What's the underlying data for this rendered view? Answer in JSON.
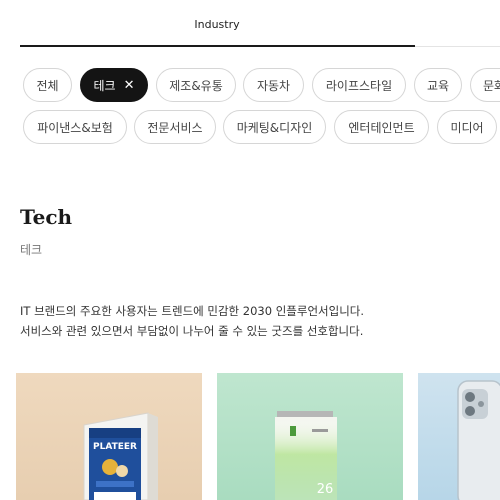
{
  "tabs": {
    "active_label": "Industry"
  },
  "filters": {
    "row1": [
      {
        "label": "전체",
        "active": false
      },
      {
        "label": "테크",
        "active": true
      },
      {
        "label": "제조&유통",
        "active": false
      },
      {
        "label": "자동차",
        "active": false
      },
      {
        "label": "라이프스타일",
        "active": false
      },
      {
        "label": "교육",
        "active": false
      },
      {
        "label": "문화",
        "active": false
      }
    ],
    "row2": [
      {
        "label": "파이낸스&보험",
        "active": false
      },
      {
        "label": "전문서비스",
        "active": false
      },
      {
        "label": "마케팅&디자인",
        "active": false
      },
      {
        "label": "엔터테인먼트",
        "active": false
      },
      {
        "label": "미디어",
        "active": false
      }
    ],
    "close_glyph": "✕"
  },
  "section": {
    "title": "Tech",
    "subtitle": "테크",
    "description_line1": "IT 브랜드의 주요한 사용자는 트렌드에 민감한 2030 인플루언서입니다.",
    "description_line2": "서비스와 관련 있으면서 부담없이 나누어 줄 수 있는 굿즈를 선호합니다."
  },
  "products": [
    {
      "name": "product-card-1",
      "print_text": "PLATEER"
    },
    {
      "name": "product-card-2",
      "print_text": "26"
    },
    {
      "name": "product-card-3",
      "print_text": ""
    }
  ],
  "colors": {
    "active_chip": "#141414",
    "card1_bg": "#efd9be",
    "card2_bg": "#bfe6cf",
    "card3_bg": "#cfe3ef"
  }
}
